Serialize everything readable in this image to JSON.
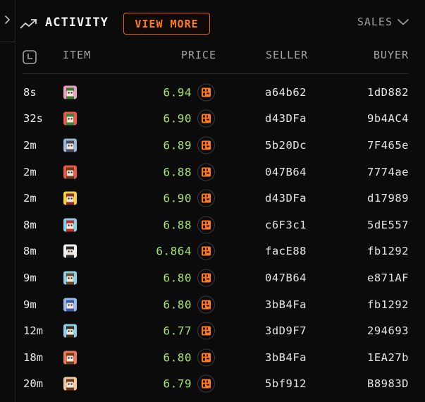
{
  "header": {
    "title": "ACTIVITY",
    "view_more_label": "VIEW MORE",
    "filter_label": "SALES",
    "accent_color": "#ff7a1a"
  },
  "columns": {
    "item": "ITEM",
    "price": "PRICE",
    "seller": "SELLER",
    "buyer": "BUYER"
  },
  "icons": {
    "collapse": "chevron-right-icon",
    "trend": "trending-up-icon",
    "time_column": "clock-icon",
    "filter": "chevron-down-icon",
    "currency": "blur-token-icon"
  },
  "rows": [
    {
      "time": "8s",
      "price": "6.94",
      "seller": "a64b62",
      "buyer": "1dD882",
      "avatar_bg": "#e8a0c8",
      "avatar_hair": "#3a7a2a"
    },
    {
      "time": "32s",
      "price": "6.90",
      "seller": "d43DFa",
      "buyer": "9b4AC4",
      "avatar_bg": "#e85a4a",
      "avatar_hair": "#2f8a3a"
    },
    {
      "time": "2m",
      "price": "6.89",
      "seller": "5b20Dc",
      "buyer": "7F465e",
      "avatar_bg": "#9bb8d8",
      "avatar_hair": "#4a4a5a"
    },
    {
      "time": "2m",
      "price": "6.88",
      "seller": "047B64",
      "buyer": "7774ae",
      "avatar_bg": "#e85a4a",
      "avatar_hair": "#6a3a1a"
    },
    {
      "time": "2m",
      "price": "6.90",
      "seller": "d43DFa",
      "buyer": "d17989",
      "avatar_bg": "#f2d23a",
      "avatar_hair": "#8a2a2a"
    },
    {
      "time": "8m",
      "price": "6.88",
      "seller": "c6F3c1",
      "buyer": "5dE557",
      "avatar_bg": "#8ad0e8",
      "avatar_hair": "#c0302a"
    },
    {
      "time": "8m",
      "price": "6.864",
      "seller": "facE88",
      "buyer": "fb1292",
      "avatar_bg": "#f0f0f0",
      "avatar_hair": "#2a2a2a"
    },
    {
      "time": "9m",
      "price": "6.80",
      "seller": "047B64",
      "buyer": "e871AF",
      "avatar_bg": "#8ad0e8",
      "avatar_hair": "#6a4a2a"
    },
    {
      "time": "9m",
      "price": "6.80",
      "seller": "3bB4Fa",
      "buyer": "fb1292",
      "avatar_bg": "#9bb8e8",
      "avatar_hair": "#3a5aa8"
    },
    {
      "time": "12m",
      "price": "6.77",
      "seller": "3dD9F7",
      "buyer": "294693",
      "avatar_bg": "#8ad0e8",
      "avatar_hair": "#3a2a1a"
    },
    {
      "time": "18m",
      "price": "6.80",
      "seller": "3bB4Fa",
      "buyer": "1EA27b",
      "avatar_bg": "#e87a5a",
      "avatar_hair": "#7a3a1a"
    },
    {
      "time": "20m",
      "price": "6.79",
      "seller": "5bf912",
      "buyer": "B8983D",
      "avatar_bg": "#f2c8a0",
      "avatar_hair": "#6a3a1a"
    }
  ]
}
